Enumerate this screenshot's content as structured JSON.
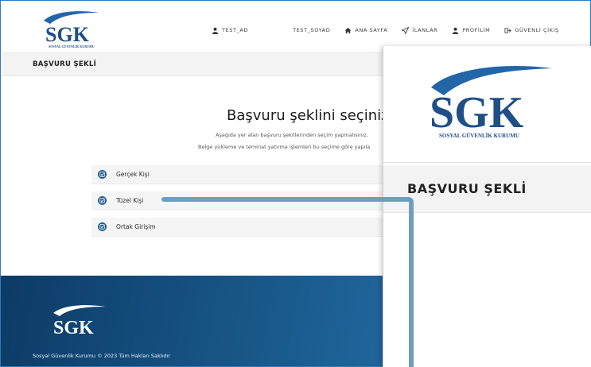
{
  "header": {
    "logo_text": "SGK",
    "logo_subtitle": "SOSYAL GÜVENLİK KURUMU",
    "nav": {
      "user_name": "TEST_AD",
      "user_surname": "TEST_SOYAD",
      "home": "ANA SAYFA",
      "listings": "İLANLAR",
      "profile": "PROFİLİM",
      "logout": "GÜVENLİ ÇIKIŞ"
    }
  },
  "subheader": {
    "title": "BAŞVURU ŞEKLİ"
  },
  "main": {
    "heading": "Başvuru şeklini seçiniz",
    "line1": "Aşağıda yer alan başvuru şekillerinden seçim yapmalısınız.",
    "line2": "Belge yükleme ve teminat yatırma işlemleri bu seçime göre yapıla",
    "options": [
      {
        "label": "Gerçek Kişi"
      },
      {
        "label": "Tüzel Kişi"
      },
      {
        "label": "Ortak Girişim"
      }
    ]
  },
  "footer": {
    "logo_text": "SGK",
    "copyright": "Sosyal Güvenlik Kurumu © 2023 Tüm Hakları Saklıdır"
  },
  "zoom": {
    "logo_text": "SGK",
    "logo_subtitle": "SOSYAL GÜVENLİK KURUMU",
    "title": "BAŞVURU ŞEKLİ"
  },
  "colors": {
    "brand_blue": "#1f5c8c",
    "footer_dark": "#0d3b66",
    "footer_light": "#2f79ae",
    "connector": "#6f9dc2"
  }
}
